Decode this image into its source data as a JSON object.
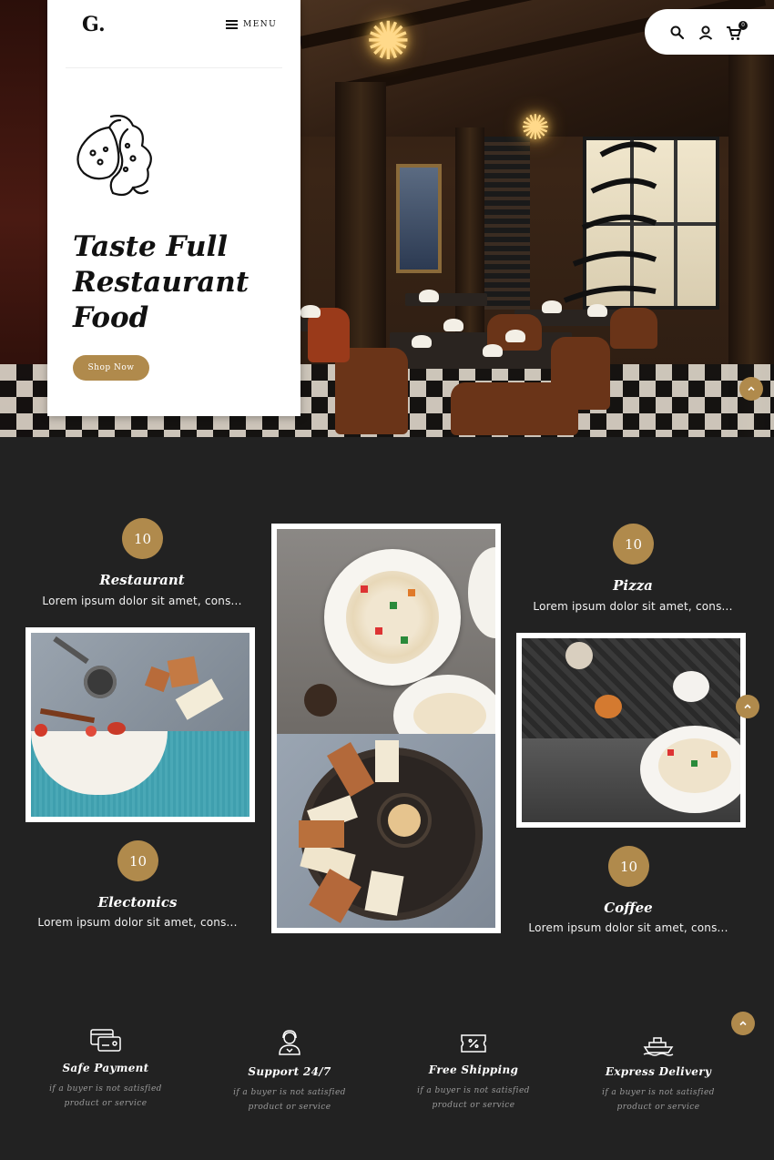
{
  "header": {
    "logo": "G.",
    "menu_label": "MENU",
    "cart_count": "0",
    "icons": [
      "search-icon",
      "user-icon",
      "cart-icon"
    ]
  },
  "hero": {
    "title_line1": "Taste Full",
    "title_line2": "Restaurant",
    "title_line3": "Food",
    "cta_label": "Shop Now"
  },
  "categories": [
    {
      "count": "10",
      "title": "Restaurant",
      "desc": "Lorem ipsum dolor sit amet, cons..."
    },
    {
      "count": "10",
      "title": "Pizza",
      "desc": "Lorem ipsum dolor sit amet, cons..."
    },
    {
      "count": "10",
      "title": "Electonics",
      "desc": "Lorem ipsum dolor sit amet, cons..."
    },
    {
      "count": "10",
      "title": "Coffee",
      "desc": "Lorem ipsum dolor sit amet, cons..."
    }
  ],
  "features": [
    {
      "icon": "credit-card-icon",
      "title": "Safe Payment",
      "desc_line1": "if a buyer is not satisfied",
      "desc_line2": "product or service"
    },
    {
      "icon": "support-agent-icon",
      "title": "Support 24/7",
      "desc_line1": "if a buyer is not satisfied",
      "desc_line2": "product or service"
    },
    {
      "icon": "discount-ticket-icon",
      "title": "Free Shipping",
      "desc_line1": "if a buyer is not satisfied",
      "desc_line2": "product or service"
    },
    {
      "icon": "ship-icon",
      "title": "Express Delivery",
      "desc_line1": "if a buyer is not satisfied",
      "desc_line2": "product or service"
    }
  ],
  "colors": {
    "accent": "#b08a4c",
    "background": "#222222",
    "card": "#ffffff"
  }
}
